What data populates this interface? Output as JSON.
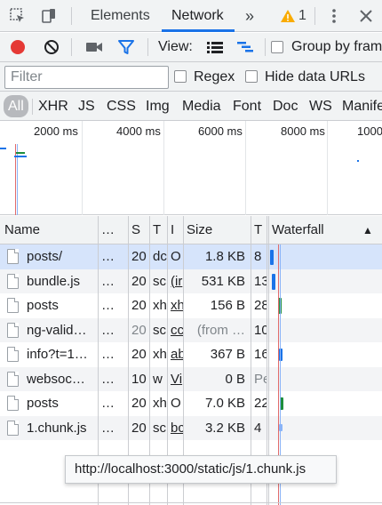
{
  "tabbar": {
    "tabs": [
      "Elements",
      "Network"
    ],
    "active_tab": "Network",
    "more_tabs_glyph": "»",
    "warning_count": "1",
    "icons": [
      "inspect-element-icon",
      "device-toolbar-icon",
      "warning-icon",
      "kebab-menu-icon",
      "close-icon"
    ]
  },
  "toolbar": {
    "record_color": "#e53935",
    "view_label": "View:",
    "group_by_frame_label": "Group by fram",
    "icons": [
      "record-icon",
      "clear-icon",
      "video-camera-icon",
      "filter-icon",
      "large-rows-icon",
      "waterfall-view-icon"
    ]
  },
  "filter_bar": {
    "placeholder": "Filter",
    "regex_label": "Regex",
    "hide_data_urls_label": "Hide data URLs"
  },
  "type_filters": {
    "items": [
      "All",
      "XHR",
      "JS",
      "CSS",
      "Img",
      "Media",
      "Font",
      "Doc",
      "WS",
      "Manife"
    ],
    "active": "All"
  },
  "overview": {
    "ticks": [
      "2000 ms",
      "4000 ms",
      "6000 ms",
      "8000 ms",
      "1000"
    ]
  },
  "columns": {
    "name": "Name",
    "ellipsis": "…",
    "status": "S",
    "type": "T",
    "initiator": "I",
    "size": "Size",
    "time": "T",
    "waterfall": "Waterfall",
    "sort_glyph": "▲"
  },
  "rows": [
    {
      "name": "posts/",
      "dots": "…",
      "status": "20",
      "type": "dc",
      "initiator": "O",
      "size": "1.8 KB",
      "time": "8",
      "selected": true
    },
    {
      "name": "bundle.js",
      "dots": "…",
      "status": "20",
      "type": "sc",
      "initiator": "(ir",
      "size": "531 KB",
      "time": "13"
    },
    {
      "name": "posts",
      "dots": "…",
      "status": "20",
      "type": "xh",
      "initiator": "xh",
      "size": "156 B",
      "time": "28"
    },
    {
      "name": "ng-valid…",
      "dots": "…",
      "status": "20",
      "type": "sc",
      "initiator": "cc",
      "size": "(from …",
      "time": "10"
    },
    {
      "name": "info?t=1…",
      "dots": "…",
      "status": "20",
      "type": "xh",
      "initiator": "ab",
      "size": "367 B",
      "time": "16"
    },
    {
      "name": "websoc…",
      "dots": "…",
      "status": "10",
      "type": "w",
      "initiator": "Vi",
      "size": "0 B",
      "time": "Pe"
    },
    {
      "name": "posts",
      "dots": "…",
      "status": "20",
      "type": "xh",
      "initiator": "O",
      "size": "7.0 KB",
      "time": "22"
    },
    {
      "name": "1.chunk.js",
      "dots": "…",
      "status": "20",
      "type": "sc",
      "initiator": "bc",
      "size": "3.2 KB",
      "time": "4"
    }
  ],
  "tooltip": {
    "text": "http://localhost:3000/static/js/1.chunk.js"
  }
}
